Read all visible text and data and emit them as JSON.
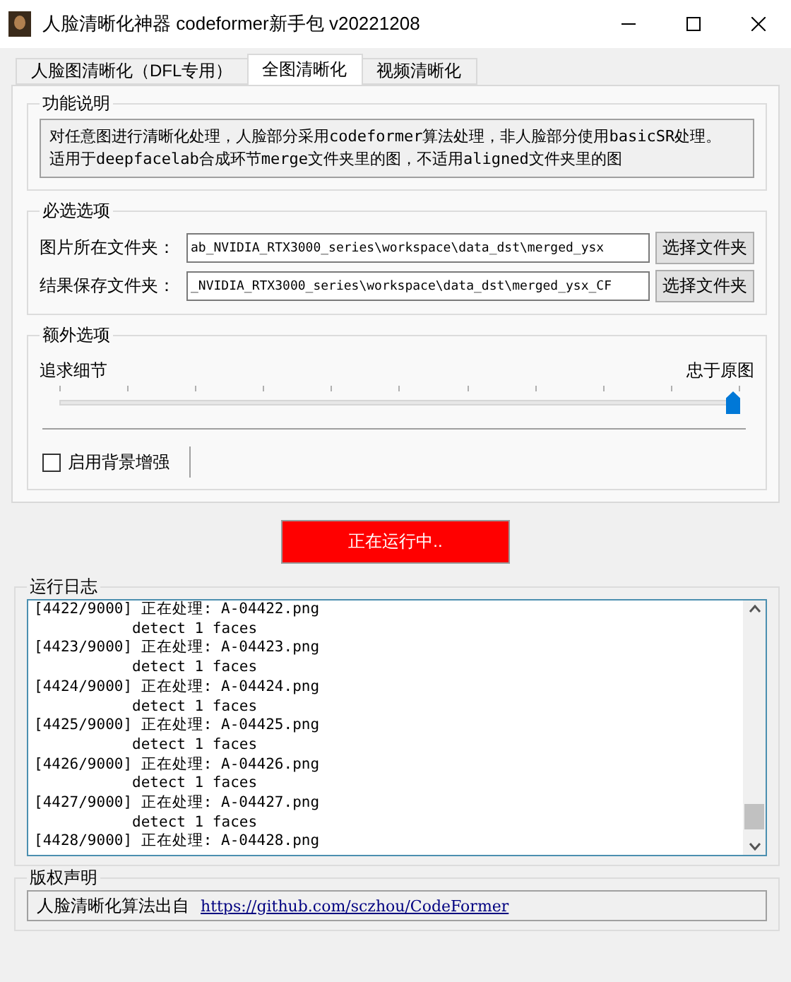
{
  "window": {
    "title": "人脸清晰化神器 codeformer新手包 v20221208"
  },
  "tabs": [
    {
      "label": "人脸图清晰化（DFL专用）",
      "selected": false
    },
    {
      "label": "全图清晰化",
      "selected": true
    },
    {
      "label": "视频清晰化",
      "selected": false
    }
  ],
  "description": {
    "title": "功能说明",
    "lines": [
      "对任意图进行清晰化处理，人脸部分采用codeformer算法处理，非人脸部分使用basicSR处理。",
      "适用于deepfacelab合成环节merge文件夹里的图，不适用aligned文件夹里的图"
    ]
  },
  "required": {
    "title": "必选选项",
    "rows": [
      {
        "label": "图片所在文件夹：",
        "value": "ab_NVIDIA_RTX3000_series\\workspace\\data_dst\\merged_ysx",
        "button": "选择文件夹"
      },
      {
        "label": "结果保存文件夹：",
        "value": "_NVIDIA_RTX3000_series\\workspace\\data_dst\\merged_ysx_CF",
        "button": "选择文件夹"
      }
    ]
  },
  "extra": {
    "title": "额外选项",
    "slider": {
      "min_label": "追求细节",
      "max_label": "忠于原图",
      "level": 1
    },
    "checkbox": {
      "label": "启用背景增强",
      "checked": false
    }
  },
  "run_button": {
    "label": "正在运行中..",
    "running": true
  },
  "log": {
    "title": "运行日志",
    "lines": [
      "[4422/9000] 正在处理: A-04422.png",
      "           detect 1 faces",
      "[4423/9000] 正在处理: A-04423.png",
      "           detect 1 faces",
      "[4424/9000] 正在处理: A-04424.png",
      "           detect 1 faces",
      "[4425/9000] 正在处理: A-04425.png",
      "           detect 1 faces",
      "[4426/9000] 正在处理: A-04426.png",
      "           detect 1 faces",
      "[4427/9000] 正在处理: A-04427.png",
      "           detect 1 faces",
      "[4428/9000] 正在处理: A-04428.png"
    ]
  },
  "copyright": {
    "title": "版权声明",
    "text": "人脸清晰化算法出自",
    "link": "https://github.com/sczhou/CodeFormer"
  }
}
